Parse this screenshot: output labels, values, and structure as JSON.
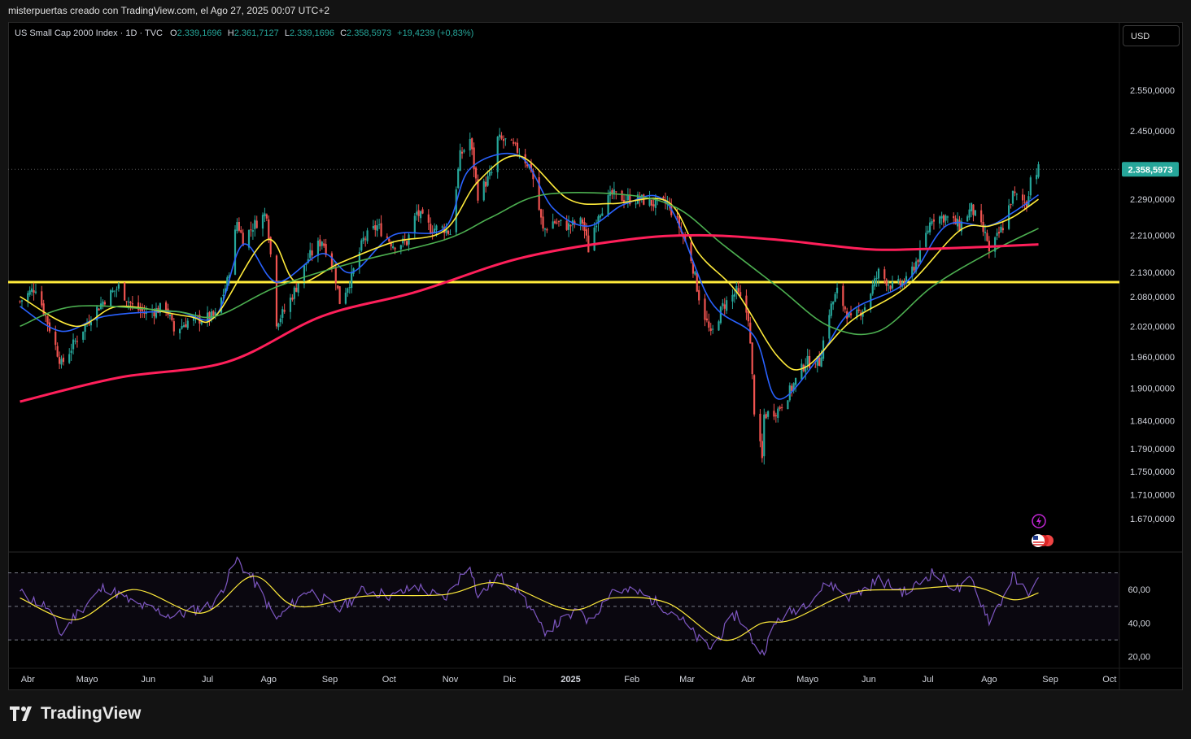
{
  "header": {
    "attribution": "misterpuertas creado con TradingView.com, el Ago 27, 2025 00:07 UTC+2"
  },
  "legend": {
    "symbol": "US Small Cap 2000 Index · 1D · TVC",
    "open_label": "O",
    "open": "2.339,1696",
    "high_label": "H",
    "high": "2.361,7127",
    "low_label": "L",
    "low": "2.339,1696",
    "close_label": "C",
    "close": "2.358,5973",
    "change": "+19,4239 (+0,83%)"
  },
  "currency_button": "USD",
  "brand": "TradingView",
  "colors": {
    "up": "#26a69a",
    "down": "#ef5350",
    "ema_blue": "#2962ff",
    "ema_yellow": "#ffeb3b",
    "ema_green": "#4caf50",
    "ema_red": "#ff1f5a",
    "level": "#ffeb3b",
    "rsi": "#7e57c2"
  },
  "icons": [
    "lightning-icon",
    "us-flag-icon"
  ],
  "chart_data": [
    {
      "type": "candlestick",
      "title": "US Small Cap 2000 Index · 1D · TVC",
      "xlabels": [
        "Abr",
        "Mayo",
        "Jun",
        "Jul",
        "Ago",
        "Sep",
        "Oct",
        "Nov",
        "Dic",
        "2025",
        "Feb",
        "Mar",
        "Abr",
        "Mayo",
        "Jun",
        "Jul",
        "Ago",
        "Sep",
        "Oct"
      ],
      "yticks": [
        "2.550,0000",
        "2.450,0000",
        "2.290,0000",
        "2.210,0000",
        "2.130,0000",
        "2.080,0000",
        "2.020,0000",
        "1.960,0000",
        "1.900,0000",
        "1.840,0000",
        "1.790,0000",
        "1.750,0000",
        "1.710,0000",
        "1.670,0000"
      ],
      "ytick_values": [
        2550,
        2450,
        2290,
        2210,
        2130,
        2080,
        2020,
        1960,
        1900,
        1840,
        1790,
        1750,
        1710,
        1670
      ],
      "log_scale": true,
      "last_price_label": "2.358,5973",
      "last_price": 2358.5973,
      "horizontal_level": 2110,
      "price_path": [
        [
          "2024-03-28",
          2070
        ],
        [
          "2024-04-05",
          2100
        ],
        [
          "2024-04-10",
          2040
        ],
        [
          "2024-04-18",
          1945
        ],
        [
          "2024-04-25",
          1990
        ],
        [
          "2024-05-03",
          2040
        ],
        [
          "2024-05-10",
          2075
        ],
        [
          "2024-05-17",
          2100
        ],
        [
          "2024-05-24",
          2060
        ],
        [
          "2024-05-31",
          2045
        ],
        [
          "2024-06-10",
          2060
        ],
        [
          "2024-06-14",
          2010
        ],
        [
          "2024-06-21",
          2030
        ],
        [
          "2024-06-28",
          2035
        ],
        [
          "2024-07-05",
          2040
        ],
        [
          "2024-07-11",
          2110
        ],
        [
          "2024-07-16",
          2240
        ],
        [
          "2024-07-19",
          2200
        ],
        [
          "2024-07-24",
          2230
        ],
        [
          "2024-07-31",
          2260
        ],
        [
          "2024-08-05",
          2030
        ],
        [
          "2024-08-09",
          2050
        ],
        [
          "2024-08-15",
          2100
        ],
        [
          "2024-08-21",
          2160
        ],
        [
          "2024-08-28",
          2200
        ],
        [
          "2024-09-03",
          2140
        ],
        [
          "2024-09-06",
          2070
        ],
        [
          "2024-09-12",
          2120
        ],
        [
          "2024-09-18",
          2200
        ],
        [
          "2024-09-25",
          2230
        ],
        [
          "2024-10-03",
          2190
        ],
        [
          "2024-10-10",
          2195
        ],
        [
          "2024-10-15",
          2260
        ],
        [
          "2024-10-22",
          2225
        ],
        [
          "2024-10-29",
          2225
        ],
        [
          "2024-11-01",
          2215
        ],
        [
          "2024-11-06",
          2390
        ],
        [
          "2024-11-11",
          2430
        ],
        [
          "2024-11-15",
          2300
        ],
        [
          "2024-11-22",
          2350
        ],
        [
          "2024-11-25",
          2430
        ],
        [
          "2024-11-29",
          2425
        ],
        [
          "2024-12-06",
          2400
        ],
        [
          "2024-12-12",
          2360
        ],
        [
          "2024-12-18",
          2220
        ],
        [
          "2024-12-23",
          2240
        ],
        [
          "2024-12-31",
          2230
        ],
        [
          "2025-01-07",
          2240
        ],
        [
          "2025-01-10",
          2180
        ],
        [
          "2025-01-15",
          2260
        ],
        [
          "2025-01-22",
          2300
        ],
        [
          "2025-01-29",
          2290
        ],
        [
          "2025-02-05",
          2290
        ],
        [
          "2025-02-12",
          2280
        ],
        [
          "2025-02-19",
          2280
        ],
        [
          "2025-02-24",
          2240
        ],
        [
          "2025-03-03",
          2160
        ],
        [
          "2025-03-07",
          2080
        ],
        [
          "2025-03-13",
          2000
        ],
        [
          "2025-03-19",
          2060
        ],
        [
          "2025-03-26",
          2090
        ],
        [
          "2025-04-01",
          2040
        ],
        [
          "2025-04-04",
          1860
        ],
        [
          "2025-04-08",
          1770
        ],
        [
          "2025-04-09",
          1850
        ],
        [
          "2025-04-16",
          1860
        ],
        [
          "2025-04-23",
          1900
        ],
        [
          "2025-04-30",
          1950
        ],
        [
          "2025-05-07",
          1950
        ],
        [
          "2025-05-12",
          2050
        ],
        [
          "2025-05-16",
          2090
        ],
        [
          "2025-05-23",
          2030
        ],
        [
          "2025-05-30",
          2060
        ],
        [
          "2025-06-06",
          2130
        ],
        [
          "2025-06-13",
          2100
        ],
        [
          "2025-06-20",
          2110
        ],
        [
          "2025-06-27",
          2170
        ],
        [
          "2025-07-03",
          2250
        ],
        [
          "2025-07-10",
          2250
        ],
        [
          "2025-07-17",
          2230
        ],
        [
          "2025-07-23",
          2270
        ],
        [
          "2025-07-31",
          2200
        ],
        [
          "2025-08-01",
          2170
        ],
        [
          "2025-08-08",
          2230
        ],
        [
          "2025-08-13",
          2300
        ],
        [
          "2025-08-20",
          2280
        ],
        [
          "2025-08-22",
          2340
        ],
        [
          "2025-08-26",
          2358.6
        ]
      ],
      "moving_averages": [
        {
          "color": "#2962ff",
          "points": [
            [
              "2024-03-28",
              2060
            ],
            [
              "2024-04-18",
              2010
            ],
            [
              "2024-05-10",
              2040
            ],
            [
              "2024-06-14",
              2050
            ],
            [
              "2024-07-05",
              2040
            ],
            [
              "2024-07-19",
              2190
            ],
            [
              "2024-08-05",
              2110
            ],
            [
              "2024-08-28",
              2170
            ],
            [
              "2024-09-12",
              2130
            ],
            [
              "2024-10-03",
              2210
            ],
            [
              "2024-10-29",
              2225
            ],
            [
              "2024-11-11",
              2360
            ],
            [
              "2024-12-06",
              2390
            ],
            [
              "2024-12-23",
              2270
            ],
            [
              "2025-01-10",
              2230
            ],
            [
              "2025-01-29",
              2280
            ],
            [
              "2025-02-19",
              2280
            ],
            [
              "2025-03-13",
              2070
            ],
            [
              "2025-04-04",
              2000
            ],
            [
              "2025-04-16",
              1880
            ],
            [
              "2025-05-07",
              1960
            ],
            [
              "2025-05-23",
              2050
            ],
            [
              "2025-06-20",
              2110
            ],
            [
              "2025-07-10",
              2230
            ],
            [
              "2025-07-31",
              2230
            ],
            [
              "2025-08-13",
              2260
            ],
            [
              "2025-08-26",
              2300
            ]
          ]
        },
        {
          "color": "#ffeb3b",
          "points": [
            [
              "2024-03-28",
              2080
            ],
            [
              "2024-04-25",
              2020
            ],
            [
              "2024-05-17",
              2060
            ],
            [
              "2024-06-21",
              2040
            ],
            [
              "2024-07-05",
              2040
            ],
            [
              "2024-07-31",
              2200
            ],
            [
              "2024-08-15",
              2110
            ],
            [
              "2024-09-06",
              2150
            ],
            [
              "2024-10-03",
              2195
            ],
            [
              "2024-10-29",
              2220
            ],
            [
              "2024-11-15",
              2330
            ],
            [
              "2024-12-06",
              2390
            ],
            [
              "2024-12-31",
              2290
            ],
            [
              "2025-01-22",
              2280
            ],
            [
              "2025-02-19",
              2285
            ],
            [
              "2025-03-07",
              2170
            ],
            [
              "2025-03-26",
              2090
            ],
            [
              "2025-04-16",
              1960
            ],
            [
              "2025-04-30",
              1940
            ],
            [
              "2025-05-23",
              2030
            ],
            [
              "2025-06-20",
              2100
            ],
            [
              "2025-07-17",
              2220
            ],
            [
              "2025-08-01",
              2230
            ],
            [
              "2025-08-13",
              2250
            ],
            [
              "2025-08-26",
              2290
            ]
          ]
        },
        {
          "color": "#4caf50",
          "points": [
            [
              "2024-03-28",
              2020
            ],
            [
              "2024-04-25",
              2060
            ],
            [
              "2024-06-14",
              2050
            ],
            [
              "2024-07-05",
              2040
            ],
            [
              "2024-08-05",
              2100
            ],
            [
              "2024-09-12",
              2150
            ],
            [
              "2024-10-29",
              2200
            ],
            [
              "2024-11-22",
              2250
            ],
            [
              "2024-12-18",
              2300
            ],
            [
              "2025-01-29",
              2300
            ],
            [
              "2025-02-24",
              2270
            ],
            [
              "2025-03-19",
              2190
            ],
            [
              "2025-04-16",
              2100
            ],
            [
              "2025-05-12",
              2020
            ],
            [
              "2025-06-06",
              2010
            ],
            [
              "2025-07-03",
              2100
            ],
            [
              "2025-07-31",
              2170
            ],
            [
              "2025-08-26",
              2225
            ]
          ]
        },
        {
          "color": "#ff1f5a",
          "points": [
            [
              "2024-03-28",
              1875
            ],
            [
              "2024-05-17",
              1920
            ],
            [
              "2024-07-11",
              1950
            ],
            [
              "2024-08-28",
              2040
            ],
            [
              "2024-10-15",
              2090
            ],
            [
              "2024-12-06",
              2160
            ],
            [
              "2025-01-29",
              2200
            ],
            [
              "2025-03-07",
              2210
            ],
            [
              "2025-04-16",
              2200
            ],
            [
              "2025-05-30",
              2180
            ],
            [
              "2025-06-27",
              2180
            ],
            [
              "2025-07-31",
              2185
            ],
            [
              "2025-08-26",
              2190
            ]
          ]
        }
      ]
    },
    {
      "type": "line",
      "title": "",
      "yticks": [
        "60,00",
        "40,00",
        "20,00"
      ],
      "ytick_values": [
        60,
        40,
        20
      ],
      "ylim": [
        15,
        80
      ],
      "bands": [
        70,
        50,
        30
      ],
      "rsi": [
        [
          "2024-03-28",
          58
        ],
        [
          "2024-04-10",
          50
        ],
        [
          "2024-04-18",
          33
        ],
        [
          "2024-04-25",
          45
        ],
        [
          "2024-05-10",
          62
        ],
        [
          "2024-05-24",
          52
        ],
        [
          "2024-06-14",
          44
        ],
        [
          "2024-06-28",
          49
        ],
        [
          "2024-07-05",
          52
        ],
        [
          "2024-07-16",
          78
        ],
        [
          "2024-07-24",
          66
        ],
        [
          "2024-08-05",
          42
        ],
        [
          "2024-08-21",
          60
        ],
        [
          "2024-09-06",
          48
        ],
        [
          "2024-09-18",
          60
        ],
        [
          "2024-10-03",
          56
        ],
        [
          "2024-10-15",
          62
        ],
        [
          "2024-10-29",
          54
        ],
        [
          "2024-11-11",
          76
        ],
        [
          "2024-11-15",
          55
        ],
        [
          "2024-11-25",
          68
        ],
        [
          "2024-12-06",
          60
        ],
        [
          "2024-12-18",
          35
        ],
        [
          "2025-01-07",
          48
        ],
        [
          "2025-01-10",
          40
        ],
        [
          "2025-01-22",
          60
        ],
        [
          "2025-02-05",
          58
        ],
        [
          "2025-02-24",
          45
        ],
        [
          "2025-03-07",
          30
        ],
        [
          "2025-03-13",
          25
        ],
        [
          "2025-03-26",
          46
        ],
        [
          "2025-04-04",
          28
        ],
        [
          "2025-04-08",
          22
        ],
        [
          "2025-04-16",
          42
        ],
        [
          "2025-04-30",
          52
        ],
        [
          "2025-05-12",
          64
        ],
        [
          "2025-05-23",
          55
        ],
        [
          "2025-06-06",
          66
        ],
        [
          "2025-06-20",
          58
        ],
        [
          "2025-07-03",
          70
        ],
        [
          "2025-07-17",
          60
        ],
        [
          "2025-07-23",
          66
        ],
        [
          "2025-08-01",
          42
        ],
        [
          "2025-08-08",
          55
        ],
        [
          "2025-08-13",
          68
        ],
        [
          "2025-08-20",
          58
        ],
        [
          "2025-08-26",
          65
        ]
      ],
      "rsi_ma": [
        [
          "2024-03-28",
          55
        ],
        [
          "2024-04-25",
          42
        ],
        [
          "2024-05-24",
          60
        ],
        [
          "2024-06-28",
          46
        ],
        [
          "2024-07-24",
          68
        ],
        [
          "2024-08-15",
          50
        ],
        [
          "2024-09-18",
          56
        ],
        [
          "2024-10-29",
          57
        ],
        [
          "2024-11-25",
          64
        ],
        [
          "2024-12-31",
          48
        ],
        [
          "2025-01-22",
          55
        ],
        [
          "2025-02-19",
          52
        ],
        [
          "2025-03-19",
          30
        ],
        [
          "2025-04-08",
          40
        ],
        [
          "2025-04-23",
          42
        ],
        [
          "2025-05-23",
          58
        ],
        [
          "2025-06-20",
          60
        ],
        [
          "2025-07-23",
          62
        ],
        [
          "2025-08-13",
          54
        ],
        [
          "2025-08-26",
          58
        ]
      ]
    }
  ]
}
